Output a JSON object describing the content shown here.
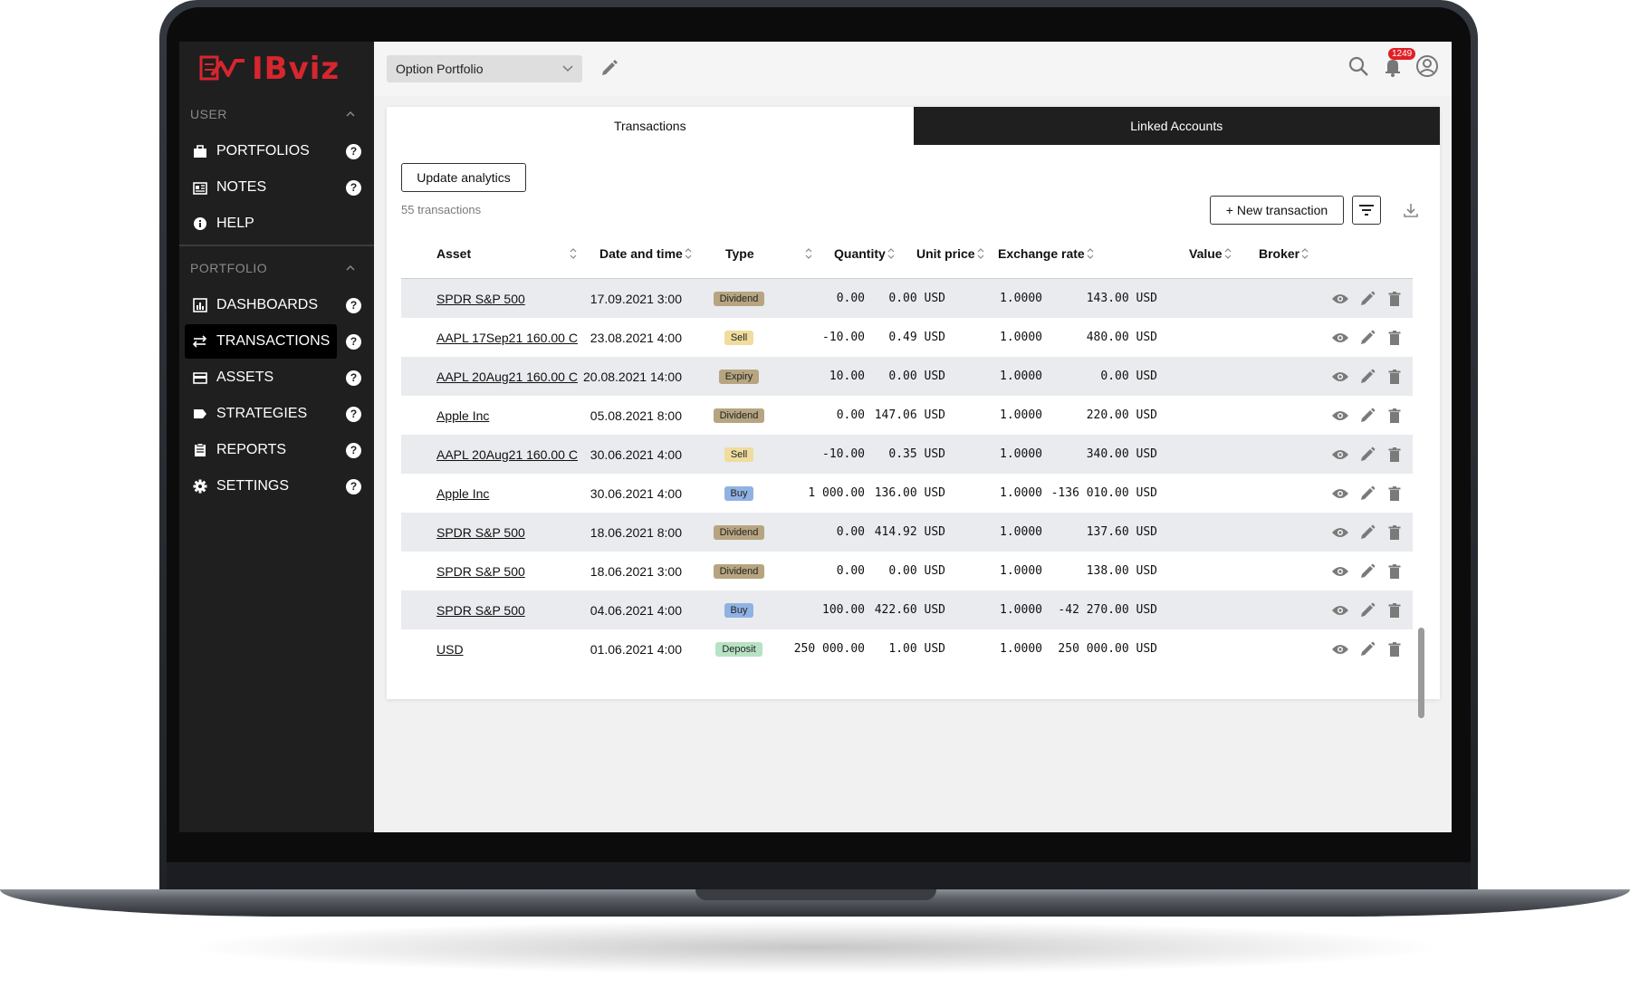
{
  "app": {
    "logo_text": "IBviz"
  },
  "sidebar": {
    "user_section": "USER",
    "user_items": [
      {
        "label": "PORTFOLIOS",
        "icon": "briefcase-icon"
      },
      {
        "label": "NOTES",
        "icon": "notes-icon"
      },
      {
        "label": "HELP",
        "icon": "info-icon"
      }
    ],
    "portfolio_section": "PORTFOLIO",
    "portfolio_items": [
      {
        "label": "DASHBOARDS",
        "icon": "dashboard-icon"
      },
      {
        "label": "TRANSACTIONS",
        "icon": "transfer-icon",
        "active": true
      },
      {
        "label": "ASSETS",
        "icon": "card-icon"
      },
      {
        "label": "STRATEGIES",
        "icon": "tag-icon"
      },
      {
        "label": "REPORTS",
        "icon": "clipboard-icon"
      },
      {
        "label": "SETTINGS",
        "icon": "gear-icon"
      }
    ],
    "help_glyph": "?"
  },
  "topbar": {
    "portfolio_value": "Option Portfolio",
    "notification_count": "1249"
  },
  "tabs": [
    "Transactions",
    "Linked Accounts"
  ],
  "toolbar": {
    "update_label": "Update analytics",
    "count_text": "55 transactions",
    "new_label": "+ New transaction"
  },
  "table": {
    "headers": {
      "asset": "Asset",
      "date": "Date and time",
      "type": "Type",
      "quantity": "Quantity",
      "unit_price": "Unit price",
      "exchange_rate": "Exchange rate",
      "value": "Value",
      "broker": "Broker"
    },
    "rows": [
      {
        "asset": "SPDR S&P 500",
        "date": "17.09.2021 3:00",
        "type": "Dividend",
        "quantity": "0.00",
        "unit_price": "0.00 USD",
        "rate": "1.0000",
        "value": "143.00 USD"
      },
      {
        "asset": "AAPL 17Sep21 160.00 C",
        "date": "23.08.2021 4:00",
        "type": "Sell",
        "quantity": "-10.00",
        "unit_price": "0.49 USD",
        "rate": "1.0000",
        "value": "480.00 USD"
      },
      {
        "asset": "AAPL 20Aug21 160.00 C",
        "date": "20.08.2021 14:00",
        "type": "Expiry",
        "quantity": "10.00",
        "unit_price": "0.00 USD",
        "rate": "1.0000",
        "value": "0.00 USD"
      },
      {
        "asset": "Apple Inc",
        "date": "05.08.2021 8:00",
        "type": "Dividend",
        "quantity": "0.00",
        "unit_price": "147.06 USD",
        "rate": "1.0000",
        "value": "220.00 USD"
      },
      {
        "asset": "AAPL 20Aug21 160.00 C",
        "date": "30.06.2021 4:00",
        "type": "Sell",
        "quantity": "-10.00",
        "unit_price": "0.35 USD",
        "rate": "1.0000",
        "value": "340.00 USD"
      },
      {
        "asset": "Apple Inc",
        "date": "30.06.2021 4:00",
        "type": "Buy",
        "quantity": "1 000.00",
        "unit_price": "136.00 USD",
        "rate": "1.0000",
        "value": "-136 010.00 USD"
      },
      {
        "asset": "SPDR S&P 500",
        "date": "18.06.2021 8:00",
        "type": "Dividend",
        "quantity": "0.00",
        "unit_price": "414.92 USD",
        "rate": "1.0000",
        "value": "137.60 USD"
      },
      {
        "asset": "SPDR S&P 500",
        "date": "18.06.2021 3:00",
        "type": "Dividend",
        "quantity": "0.00",
        "unit_price": "0.00 USD",
        "rate": "1.0000",
        "value": "138.00 USD"
      },
      {
        "asset": "SPDR S&P 500",
        "date": "04.06.2021 4:00",
        "type": "Buy",
        "quantity": "100.00",
        "unit_price": "422.60 USD",
        "rate": "1.0000",
        "value": "-42 270.00 USD"
      },
      {
        "asset": "USD",
        "date": "01.06.2021 4:00",
        "type": "Deposit",
        "quantity": "250 000.00",
        "unit_price": "1.00 USD",
        "rate": "1.0000",
        "value": "250 000.00 USD"
      }
    ]
  },
  "type_colors": {
    "Dividend": "#b6a580",
    "Sell": "#f0dc9e",
    "Expiry": "#b6a580",
    "Buy": "#8fb2e3",
    "Deposit": "#b7e2c4"
  },
  "colors": {
    "brand": "#d7262e",
    "sidebar_bg": "#1f1f1f"
  }
}
